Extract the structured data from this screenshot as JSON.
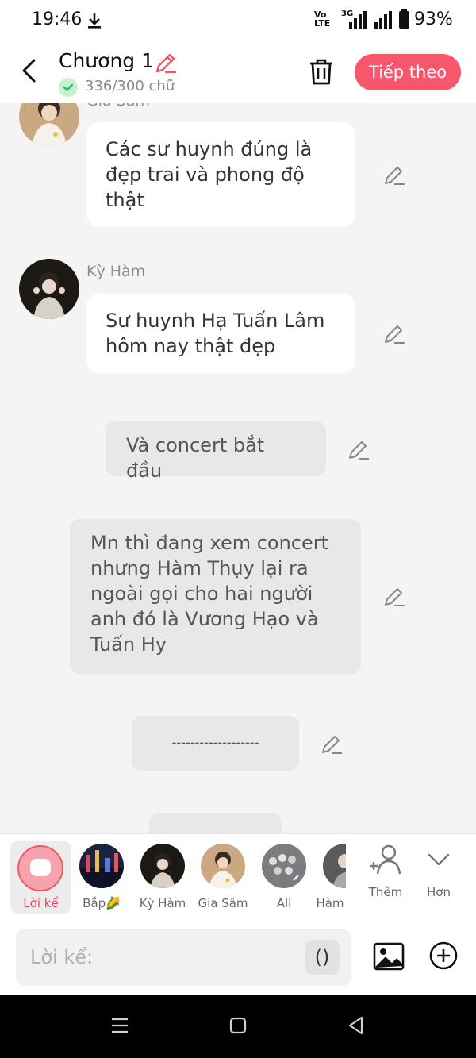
{
  "status": {
    "time": "19:46",
    "network_top": "Vo",
    "network_bottom": "LTE",
    "net_3g": "3G",
    "battery": "93%"
  },
  "header": {
    "title": "Chương 1",
    "word_count": "336/300 chữ",
    "next_label": "Tiếp theo"
  },
  "messages": [
    {
      "sender": "Gia Sâm",
      "text": "Các sư huynh đúng là đẹp trai và phong độ thật"
    },
    {
      "sender": "Kỳ Hàm",
      "text": "Sư huynh Hạ Tuấn Lâm hôm nay thật đẹp"
    }
  ],
  "narrations": [
    {
      "text": "Và concert bắt đầu"
    },
    {
      "text": "Mn thì đang xem concert nhưng Hàm Thụy lại ra ngoài gọi cho hai người anh đó là Vương Hạo và Tuấn Hy"
    },
    {
      "text": "-------------------"
    }
  ],
  "characters": [
    {
      "label": "Lời kể"
    },
    {
      "label": "Bắp🌽"
    },
    {
      "label": "Kỳ Hàm"
    },
    {
      "label": "Gia Sâm"
    },
    {
      "label": "All"
    },
    {
      "label": "Hàm"
    }
  ],
  "extra": {
    "add_label": "Thêm",
    "more_label": "Hơn"
  },
  "input": {
    "placeholder": "Lời kể:",
    "paren": "()"
  },
  "colors": {
    "accent": "#f7566d",
    "check_green": "#34c060",
    "bubble": "#ffffff",
    "narration": "#e8e8e8"
  }
}
